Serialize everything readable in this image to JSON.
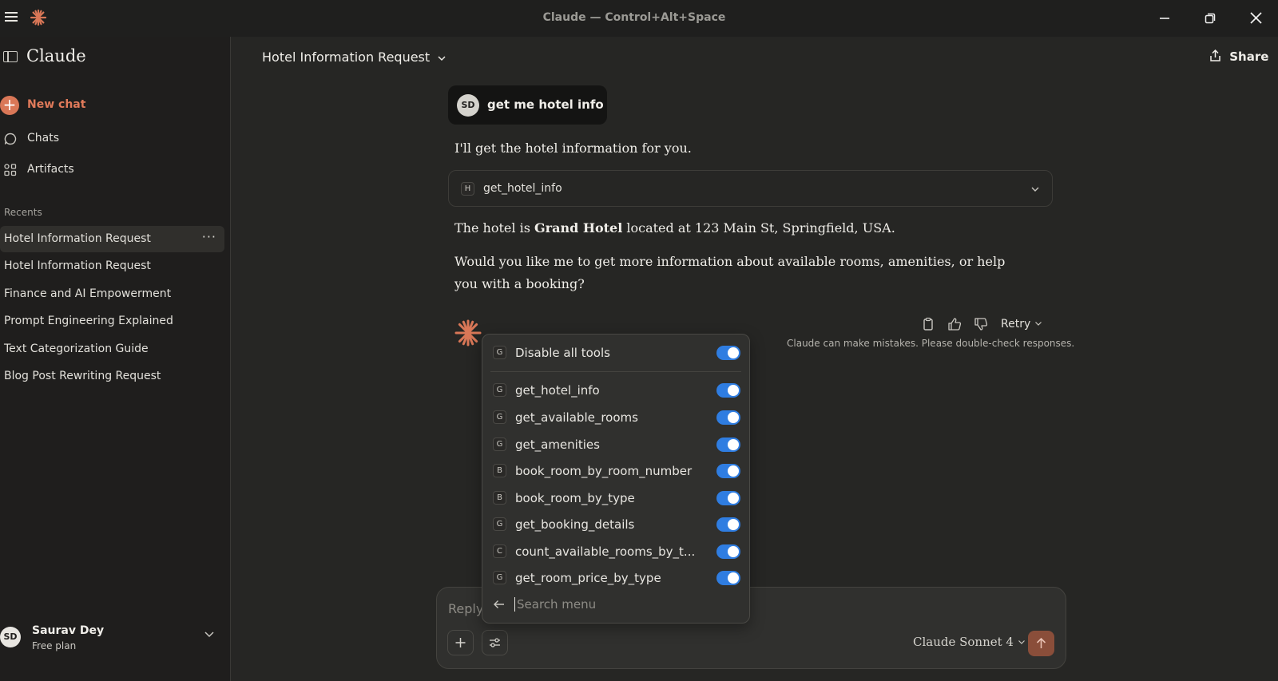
{
  "window": {
    "title": "Claude — Control+Alt+Space",
    "controls": [
      "minimize-icon",
      "restore-icon",
      "close-icon"
    ]
  },
  "sidebar": {
    "brand": "Claude",
    "new_chat": "New chat",
    "nav": [
      {
        "label": "Chats",
        "icon": "chat-bubble-icon"
      },
      {
        "label": "Artifacts",
        "icon": "artifacts-icon"
      }
    ],
    "recents_heading": "Recents",
    "recents": [
      {
        "label": "Hotel Information Request",
        "active": true
      },
      {
        "label": "Hotel Information Request"
      },
      {
        "label": "Finance and AI Empowerment"
      },
      {
        "label": "Prompt Engineering Explained"
      },
      {
        "label": "Text Categorization Guide"
      },
      {
        "label": "Blog Post Rewriting Request"
      }
    ],
    "more": "···",
    "user": {
      "initials": "SD",
      "name": "Saurav Dey",
      "plan": "Free plan"
    }
  },
  "header": {
    "chat_title": "Hotel Information Request",
    "share": "Share"
  },
  "conversation": {
    "user_initials": "SD",
    "user_message": "get me hotel info",
    "assistant_intro": "I'll get the hotel information for you.",
    "tool_call": {
      "badge": "H",
      "name": "get_hotel_info"
    },
    "answer_prefix": "The hotel is ",
    "answer_bold": "Grand Hotel",
    "answer_suffix": " located at 123 Main St, Springfield, USA.",
    "followup": "Would you like me to get more information about available rooms, amenities, or help you with a booking?",
    "retry": "Retry",
    "disclaimer": "Claude can make mistakes. Please double-check responses."
  },
  "tools_menu": {
    "disable_all": {
      "badge": "G",
      "label": "Disable all tools",
      "enabled": true
    },
    "tools": [
      {
        "badge": "G",
        "label": "get_hotel_info",
        "enabled": true
      },
      {
        "badge": "G",
        "label": "get_available_rooms",
        "enabled": true
      },
      {
        "badge": "G",
        "label": "get_amenities",
        "enabled": true
      },
      {
        "badge": "B",
        "label": "book_room_by_room_number",
        "enabled": true
      },
      {
        "badge": "B",
        "label": "book_room_by_type",
        "enabled": true
      },
      {
        "badge": "G",
        "label": "get_booking_details",
        "enabled": true
      },
      {
        "badge": "C",
        "label": "count_available_rooms_by_t...",
        "enabled": true
      },
      {
        "badge": "G",
        "label": "get_room_price_by_type",
        "enabled": true
      }
    ],
    "search_placeholder": "Search menu"
  },
  "composer": {
    "placeholder": "Reply",
    "model": "Claude Sonnet 4"
  },
  "colors": {
    "accent": "#d97757",
    "toggle_on": "#2f7de1",
    "background": "#262624",
    "sidebar": "#1f1e1d"
  }
}
